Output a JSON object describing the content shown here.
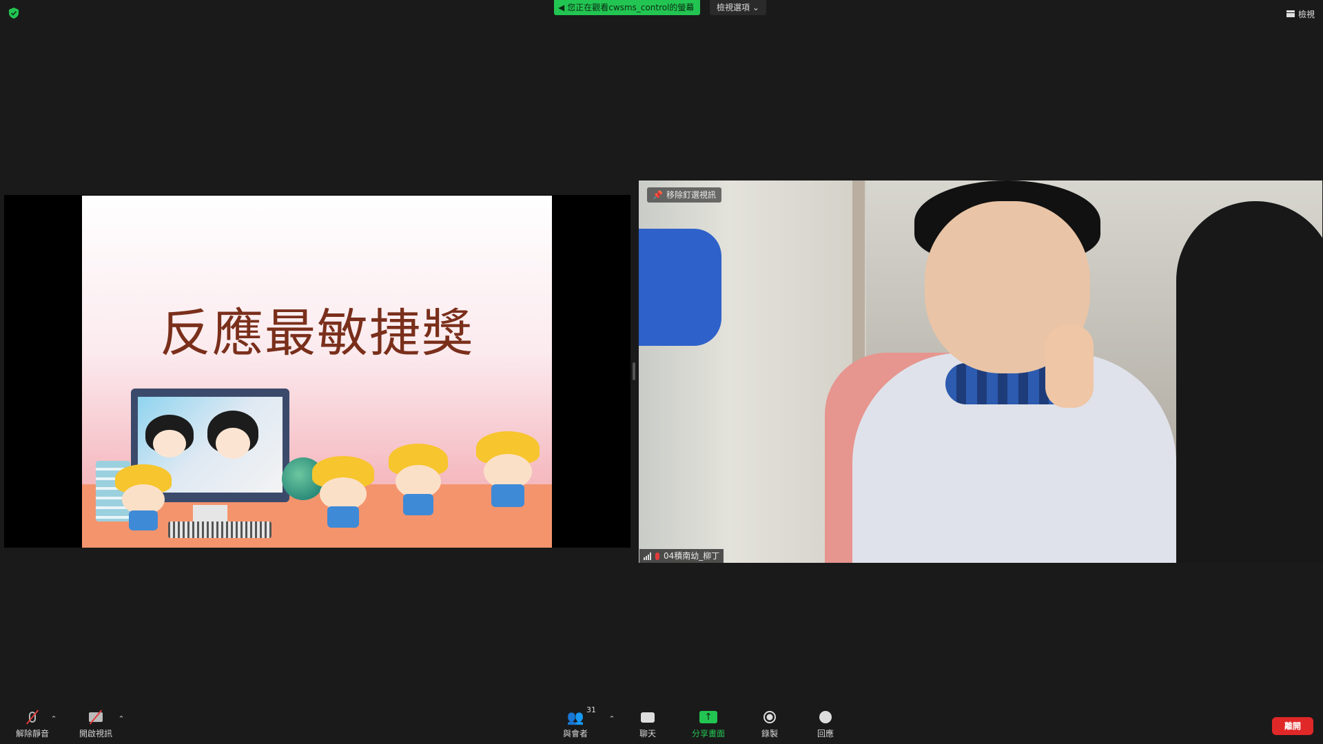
{
  "top_bar": {
    "banner_text": "您正在觀看cwsms_control的螢幕",
    "view_options_label": "檢視選項 ⌄",
    "view_label": "檢視"
  },
  "slide": {
    "title": "反應最敏捷獎"
  },
  "video": {
    "pin_label": "移除釘選視訊",
    "participant_name": "04積南幼_柳丁"
  },
  "toolbar": {
    "unmute_label": "解除靜音",
    "start_video_label": "開啟視訊",
    "participants_label": "與會者",
    "participants_count": "31",
    "chat_label": "聊天",
    "share_label": "分享畫面",
    "record_label": "錄製",
    "reactions_label": "回應",
    "leave_label": "離開"
  },
  "colors": {
    "accent_green": "#23c552",
    "leave_red": "#e02828",
    "background": "#1a1a1a"
  },
  "icons": [
    "shield-icon",
    "sound-icon",
    "grid-view-icon",
    "pin-icon",
    "signal-icon",
    "mic-muted-icon",
    "camera-off-icon",
    "participants-icon",
    "chat-icon",
    "share-screen-icon",
    "record-icon",
    "reactions-icon",
    "caret-up-icon"
  ]
}
